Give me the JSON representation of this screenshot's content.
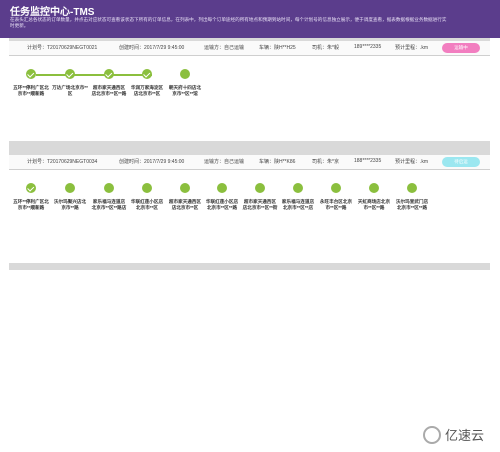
{
  "header": {
    "title": "任务监控中心-TMS",
    "desc": "在表头汇总各状态的订单数量，并点击对应状态可查看该状态下所有的订单信息，在列表中，列出每个订单途经的所有地点和预期到站时间，每个计划号的信息独立展示，便于调度查看，据表数据根据业务数据进行实时更新。"
  },
  "orders": [
    {
      "plan_no": "计划号：T20170629NEGT0021",
      "create_time": "创建时间：2017/7/29 9:45:00",
      "transport": "运输方：自己运输",
      "plate": "车辆：陕H**H25",
      "driver": "司机：朱*毅",
      "phone": "189****2335",
      "mileage": "预计里程：.km",
      "status": "运输中",
      "status_color": "#f27ec0",
      "stops": [
        {
          "label": "五环**停利广区北京市**顺新路",
          "done": true
        },
        {
          "label": "万达广场北京市**区",
          "done": true
        },
        {
          "label": "超市家天通西区店北京市**区**路",
          "done": true
        },
        {
          "label": "华润万家海淀区店北京市**区",
          "done": true
        },
        {
          "label": "朝天府十四店北京市**区**馆",
          "done": false
        }
      ]
    },
    {
      "plan_no": "计划号：T20170629NEGT0034",
      "create_time": "创建时间：2017/7/29 9:45:00",
      "transport": "运输方：自己运输",
      "plate": "车辆：陕H**K86",
      "driver": "司机：朱*京",
      "phone": "188****2335",
      "mileage": "预计里程：.km",
      "status": "待启运",
      "status_color": "#9be7f0",
      "stops": [
        {
          "label": "五环**停利广区北京市**顺新路",
          "done": true
        },
        {
          "label": "沃尔玛聚兴店北京市**路",
          "done": false
        },
        {
          "label": "家乐福马连道店北京市**区**路店",
          "done": false
        },
        {
          "label": "华联红莲小区店北京市**区",
          "done": false
        },
        {
          "label": "超市家天通西区店北京市**区",
          "done": false
        },
        {
          "label": "华联红莲小区店北京市**区**路",
          "done": false
        },
        {
          "label": "超市家天通西区店北京市**区**街",
          "done": false
        },
        {
          "label": "家乐福马连道店北京市**区**店",
          "done": false
        },
        {
          "label": "永旺丰台区北京市**区**路",
          "done": false
        },
        {
          "label": "天虹商场店北京市**区**路",
          "done": false
        },
        {
          "label": "沃尔玛宣武门店北京市**区**路",
          "done": false
        }
      ]
    }
  ],
  "footer": {
    "logo_text": "亿速云"
  }
}
